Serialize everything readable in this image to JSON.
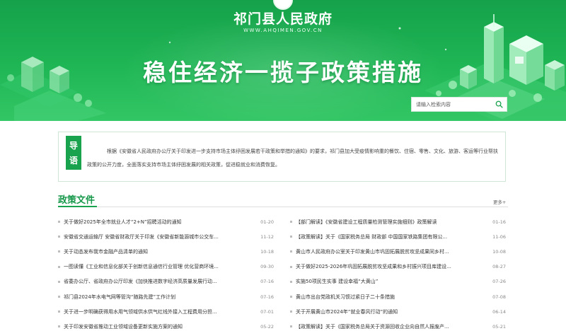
{
  "header": {
    "site_title": "祁门县人民政府",
    "site_domain": "WWW.AHQIMEN.GOV.CN",
    "slogan": "稳住经济一揽子政策措施",
    "search_placeholder": "请输入检索内容"
  },
  "intro": {
    "tag_char1": "导",
    "tag_char2": "语",
    "text": "根据《安徽省人民政府办公厅关于印发进一步支持市场主体纾困发展若干政策和举措的通知》的要求，祁门县加大受疫情影响重的餐饮、住宿、零售、文化、旅游、客运等行业帮扶政策的公开力度，全面落实支持市场主体纾困发展的相关政策，促进稳就业和消费恢复。"
  },
  "section": {
    "title": "政策文件",
    "more": "更多+"
  },
  "left_news": [
    {
      "title": "关于做好2025年全市就业人才“2+N”招聘活动的通知",
      "date": "01-20"
    },
    {
      "title": "安徽省交通运输厅 安徽省财政厅关于印发《安徽省新能源城市公交车...",
      "date": "11-12"
    },
    {
      "title": "关于动态发布我市金融产品清单的通知",
      "date": "10-18"
    },
    {
      "title": "一图读懂《工业和信息化部关于创新信息通信行业管理 优化营商环境...",
      "date": "09-30"
    },
    {
      "title": "省委办公厅、省政府办公厅印发《加快推进数字经济高质量发展行动...",
      "date": "07-16"
    },
    {
      "title": "祁门县2024年水电气网等管沟“随路先建”工作计划",
      "date": "07-16"
    },
    {
      "title": "关于进一步明确获得用水用气领域供水供气红线外接入工程费用分担...",
      "date": "07-01"
    },
    {
      "title": "关于印发安徽省推动工业领域设备更新实施方案的通知",
      "date": "05-22"
    }
  ],
  "right_news": [
    {
      "title": "【部门解读】《安徽省建设工程质量检测管理实施细则》政策解读",
      "date": "01-16"
    },
    {
      "title": "【政策解读】关于《国家税务总局 财政部 中国国家铁路集团有限公...",
      "date": "11-06"
    },
    {
      "title": "黄山市人民政府办公室关于印发黄山市巩固拓展脱贫攻坚成果同乡村...",
      "date": "10-08"
    },
    {
      "title": "关于做好2025-2026年巩固拓展脱贫攻坚成果和乡村振兴项目库建设...",
      "date": "08-27"
    },
    {
      "title": "实施50项民生实事 建设幸福“大黄山”",
      "date": "07-26"
    },
    {
      "title": "黄山市出台党政机关习惯过紧日子二十条措施",
      "date": "07-08"
    },
    {
      "title": "关于开展黄山市2024年“就业春风行动”的通知",
      "date": "06-14"
    },
    {
      "title": "【政策解读】关于《国家税务总局关于资源回收企业向自然人报废产...",
      "date": "05-21"
    }
  ],
  "colors": {
    "brand_green": "#1aa34f",
    "banner_top": "#15a14a",
    "banner_bottom": "#33c665"
  }
}
